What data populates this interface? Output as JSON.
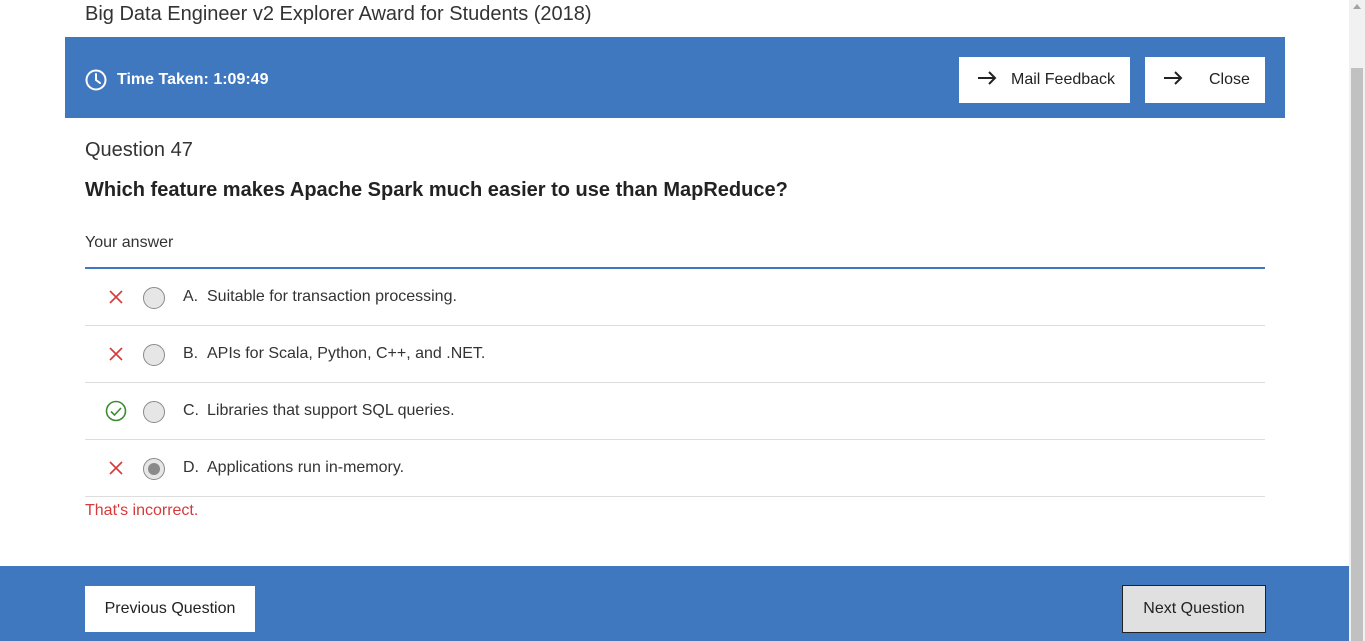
{
  "header": {
    "title": "Big Data Engineer v2 Explorer Award for Students (2018)"
  },
  "toolbar": {
    "time_label": "Time Taken: 1:09:49",
    "mail_feedback_label": "Mail Feedback",
    "close_label": "Close",
    "accent_color": "#4078c0"
  },
  "question": {
    "number_label": "Question 47",
    "text": "Which feature makes Apache Spark much easier to use than MapReduce?",
    "your_answer_label": "Your answer",
    "options": [
      {
        "letter": "A.",
        "text": "Suitable for transaction processing.",
        "status_icon": "cross-icon",
        "selected": false,
        "correct": false
      },
      {
        "letter": "B.",
        "text": "APIs for Scala, Python, C++, and .NET.",
        "status_icon": "cross-icon",
        "selected": false,
        "correct": false
      },
      {
        "letter": "C.",
        "text": "Libraries that support SQL queries.",
        "status_icon": "check-circle-icon",
        "selected": false,
        "correct": true
      },
      {
        "letter": "D.",
        "text": "Applications run in-memory.",
        "status_icon": "cross-icon",
        "selected": true,
        "correct": false
      }
    ],
    "feedback": "That's incorrect.",
    "incorrect_color": "#d63a3a",
    "correct_color": "#3d8b2f"
  },
  "navigation": {
    "previous_label": "Previous Question",
    "next_label": "Next Question"
  }
}
